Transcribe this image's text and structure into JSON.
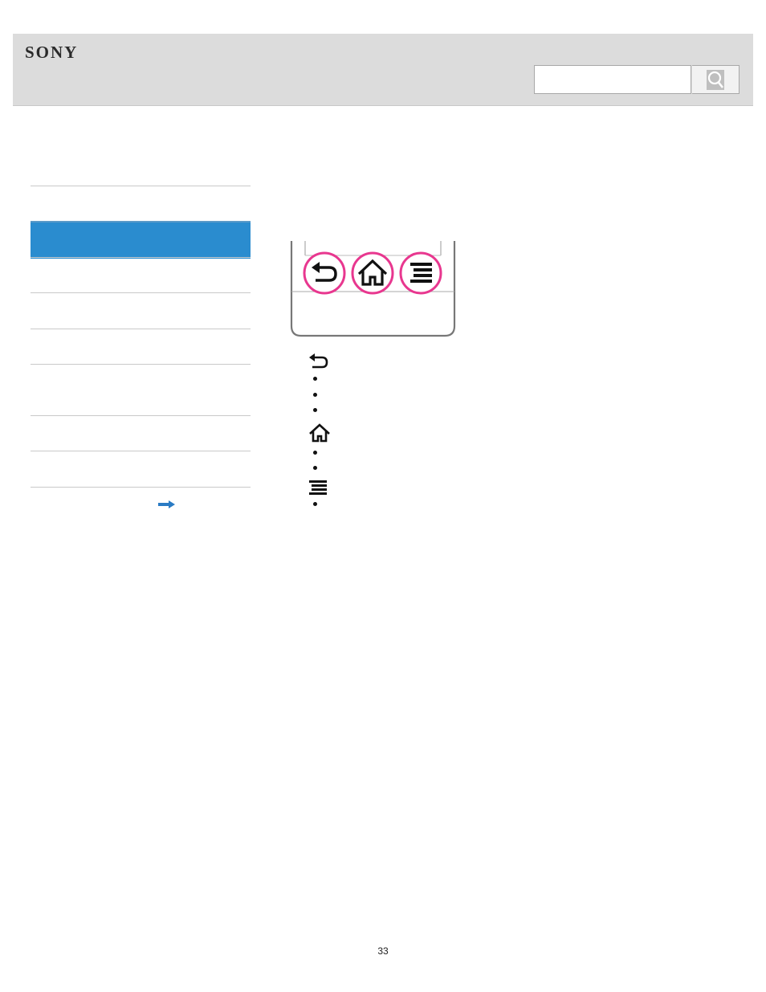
{
  "header": {
    "brand": "SONY",
    "search": {
      "value": "",
      "placeholder": ""
    },
    "search_button_icon": "search-icon",
    "background": "#dcdcdc"
  },
  "sidebar": {
    "active_color": "#2a8ccf",
    "items": [
      {
        "label": "",
        "active": false
      },
      {
        "label": "",
        "active": true
      },
      {
        "label": "",
        "active": false
      },
      {
        "label": "",
        "active": false
      },
      {
        "label": "",
        "active": false
      },
      {
        "label": "",
        "active": false
      },
      {
        "label": "",
        "active": false
      },
      {
        "label": "",
        "active": false
      }
    ],
    "link_icon": "arrow-right-icon"
  },
  "figure": {
    "buttons": [
      "back-icon",
      "home-icon",
      "menu-icon"
    ],
    "highlight_color": "#e8378f"
  },
  "key_list": [
    {
      "icon": "back-icon",
      "bullets": [
        "",
        "",
        ""
      ]
    },
    {
      "icon": "home-icon",
      "bullets": [
        "",
        ""
      ]
    },
    {
      "icon": "menu-icon",
      "bullets": [
        ""
      ]
    }
  ],
  "footer": {
    "page_number": "33"
  }
}
